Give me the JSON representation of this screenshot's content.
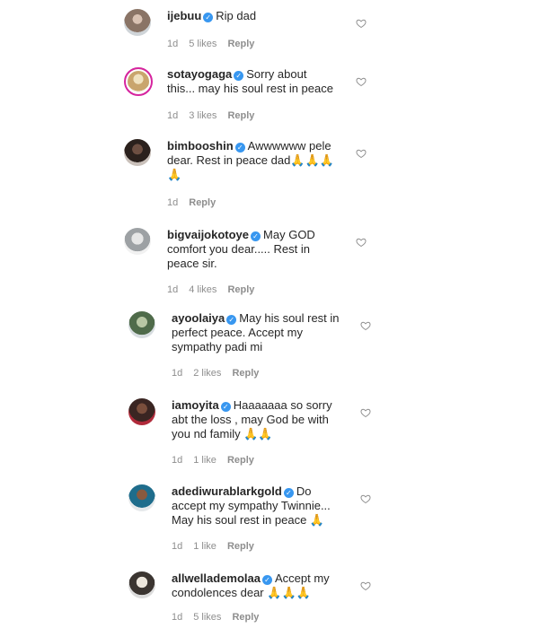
{
  "comments": [
    {
      "username": "ijebuu",
      "text": "Rip dad",
      "emoji": "",
      "time": "1d",
      "likes": "5 likes",
      "reply": "Reply"
    },
    {
      "username": "sotayogaga",
      "text": "Sorry about this... may his soul rest in peace",
      "emoji": "",
      "time": "1d",
      "likes": "3 likes",
      "reply": "Reply"
    },
    {
      "username": "bimbooshin",
      "text": "Awwwwww pele dear. Rest in peace dad",
      "emoji": "🙏🙏🙏🙏",
      "time": "1d",
      "likes": "",
      "reply": "Reply"
    },
    {
      "username": "bigvaijokotoye",
      "text": "May GOD comfort you dear..... Rest in peace sir.",
      "emoji": "",
      "time": "1d",
      "likes": "4 likes",
      "reply": "Reply"
    },
    {
      "username": "ayoolaiya",
      "text": "May his soul rest in perfect peace. Accept my sympathy padi mi",
      "emoji": "",
      "time": "1d",
      "likes": "2 likes",
      "reply": "Reply"
    },
    {
      "username": "iamoyita",
      "text": "Haaaaaaa so sorry abt the loss , may God be with you nd family",
      "emoji": "🙏🙏",
      "time": "1d",
      "likes": "1 like",
      "reply": "Reply"
    },
    {
      "username": "adediwurablarkgold",
      "text": "Do accept my sympathy Twinnie... May his soul rest in peace",
      "emoji": "🙏",
      "time": "1d",
      "likes": "1 like",
      "reply": "Reply"
    },
    {
      "username": "allwellademolaa",
      "text": "Accept my condolences dear",
      "emoji": "🙏🙏🙏",
      "time": "1d",
      "likes": "5 likes",
      "reply": "Reply"
    }
  ],
  "icons": {
    "verified": "verified-badge-icon",
    "like": "heart-icon"
  },
  "colors": {
    "verified": "#3897f0",
    "meta": "#8e8e8e",
    "story_ring": "#d6249f"
  }
}
